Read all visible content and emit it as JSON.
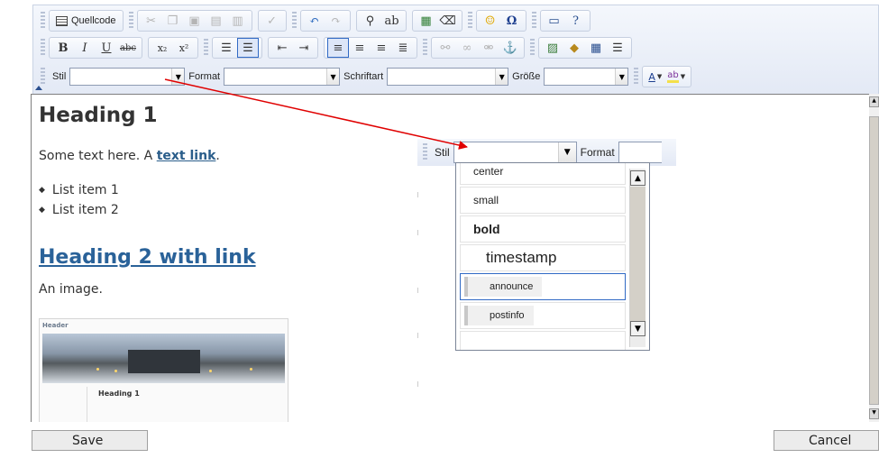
{
  "toolbar": {
    "row1": {
      "source_label": "Quellcode"
    },
    "combos": {
      "style_label": "Stil",
      "format_label": "Format",
      "font_label": "Schriftart",
      "size_label": "Größe"
    },
    "icons_row1": [
      "cut-icon",
      "copy-icon",
      "paste-icon",
      "paste-text-icon",
      "paste-word-icon",
      "spellcheck-icon",
      "undo-icon",
      "redo-icon",
      "find-icon",
      "replace-icon",
      "select-all-icon",
      "eraser-icon",
      "smiley-icon",
      "special-char-icon",
      "show-blocks-icon",
      "help-icon"
    ],
    "row2": {
      "bold": "B",
      "italic": "I",
      "underline": "U",
      "strike": "abc",
      "subscript": "x₂",
      "superscript": "x²"
    }
  },
  "content": {
    "heading1": "Heading 1",
    "para1_text": "Some text here. A ",
    "para1_link": "text link",
    "para1_end": ".",
    "list_items": [
      "List item 1",
      "List item 2"
    ],
    "heading2_link": "Heading 2 with link",
    "para2": "An image.",
    "thumbnail": {
      "header": "Header",
      "heading": "Heading 1"
    }
  },
  "inset": {
    "style_label": "Stil",
    "format_label": "Format",
    "dropdown_items": [
      {
        "label": "center",
        "style": "sz-sm"
      },
      {
        "label": "small",
        "style": "sz-sm"
      },
      {
        "label": "bold",
        "style": "sz-bold"
      },
      {
        "label": "timestamp",
        "style": "sz-lg"
      },
      {
        "label": "announce",
        "style": "boxed",
        "selected": true
      },
      {
        "label": "postinfo",
        "style": "boxed"
      },
      {
        "label": "",
        "style": "sz-sm"
      }
    ]
  },
  "buttons": {
    "save": "Save",
    "cancel": "Cancel"
  },
  "colors": {
    "accent": "#316ac5",
    "link": "#2a6299",
    "arrow": "#e00000"
  }
}
